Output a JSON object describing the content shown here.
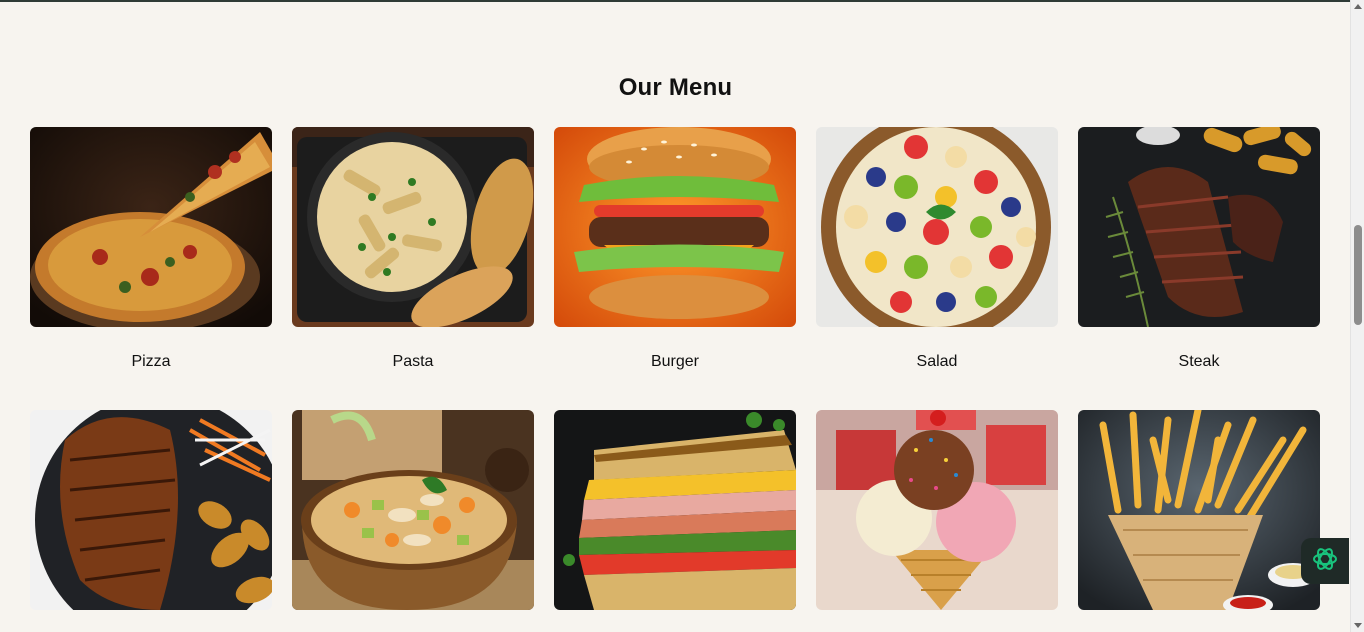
{
  "menu": {
    "title": "Our Menu",
    "items": [
      {
        "label": "Pizza"
      },
      {
        "label": "Pasta"
      },
      {
        "label": "Burger"
      },
      {
        "label": "Salad"
      },
      {
        "label": "Steak"
      },
      {
        "label": ""
      },
      {
        "label": ""
      },
      {
        "label": ""
      },
      {
        "label": ""
      },
      {
        "label": ""
      }
    ]
  },
  "icons": {
    "chat_widget": "openai-logo-icon"
  },
  "colors": {
    "background": "#f7f4ef",
    "widget": "#1f2a27",
    "widget_icon": "#19c37d"
  }
}
